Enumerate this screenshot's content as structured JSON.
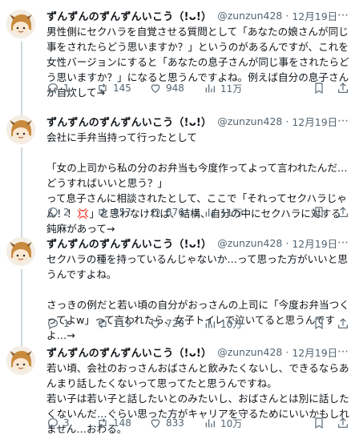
{
  "tweets": [
    {
      "display_name": "ずんずんのずんずんいこう（!ᴗ!）",
      "handle": "@zunzun428",
      "date": "12月19日",
      "text": "男性側にセクハラを自覚させる質問として「あなたの娘さんが同じ事をされたらどう思いますか？」というのがあるんですが、これを女性バージョンにすると「あなたの息子さんが同じ事をされたらどう思いますか？」になると思うんですよね。例えば自分の息子さんが自炊して→",
      "replies": "1",
      "retweets": "145",
      "likes": "948",
      "views": "11万"
    },
    {
      "display_name": "ずんずんのずんずんいこう（!ᴗ!）",
      "handle": "@zunzun428",
      "date": "12月19日",
      "text": "会社に手弁当持って行ったとして\n\n「女の上司から私の分のお弁当も今度作ってよって言われたんだ…どうすればいいと思う？」\nって息子さんに相談されたとして、ここで「それってセクハラじゃん！！💢」と思わなければ、結構、自分の中にセクハラに対する鈍麻があって→",
      "replies": "2",
      "retweets": "157",
      "likes": "876",
      "views": "11万"
    },
    {
      "display_name": "ずんずんのずんずんいこう（!ᴗ!）",
      "handle": "@zunzun428",
      "date": "12月19日",
      "text": "セクハラの種を持っているんじゃないか…って思った方がいいと思うんですよね。\n\nさっきの例だと若い頃の自分がおっさんの上司に「今度お弁当つくってよw」って言われたら、女子トイレで泣いてると思うんですよ…→",
      "replies": "1",
      "retweets": "119",
      "likes": "720",
      "views": "10万"
    },
    {
      "display_name": "ずんずんのずんずんいこう（!ᴗ!）",
      "handle": "@zunzun428",
      "date": "12月19日",
      "text": "若い頃、会社のおっさんおばさんと飲みたくないし、できるならあんまり話したくないって思ってたと思うんですね。\n若い子は若い子と話したいとのみたいし、おばさんとは別に話したくないんだ…ぐらい思った方がキャリアを守るためにいいかもしれません…おわる。",
      "replies": "3",
      "retweets": "148",
      "likes": "833",
      "views": "10万"
    }
  ],
  "colors": {
    "text": "#0f1419",
    "muted": "#536471",
    "verified": "#1d9bf0",
    "thread_line": "#cfd9de"
  },
  "icons": [
    "avatar",
    "verified-badge-icon",
    "more-icon",
    "reply-icon",
    "retweet-icon",
    "like-icon",
    "views-icon",
    "bookmark-icon",
    "share-icon"
  ]
}
